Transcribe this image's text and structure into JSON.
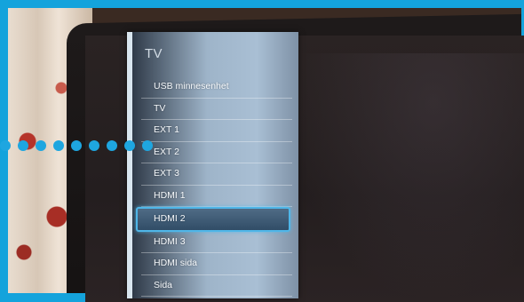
{
  "colors": {
    "frame": "#14a3dc",
    "selection_border": "#4fb6e8",
    "dots": "#1ea6e0"
  },
  "menu": {
    "title": "TV",
    "items": [
      {
        "label": "USB minnesenhet"
      },
      {
        "label": "TV"
      },
      {
        "label": "EXT 1"
      },
      {
        "label": "EXT 2"
      },
      {
        "label": "EXT 3"
      },
      {
        "label": "HDMI 1"
      },
      {
        "label": "HDMI 2",
        "selected": true
      },
      {
        "label": "HDMI 3"
      },
      {
        "label": "HDMI sida"
      },
      {
        "label": "Sida"
      }
    ]
  }
}
